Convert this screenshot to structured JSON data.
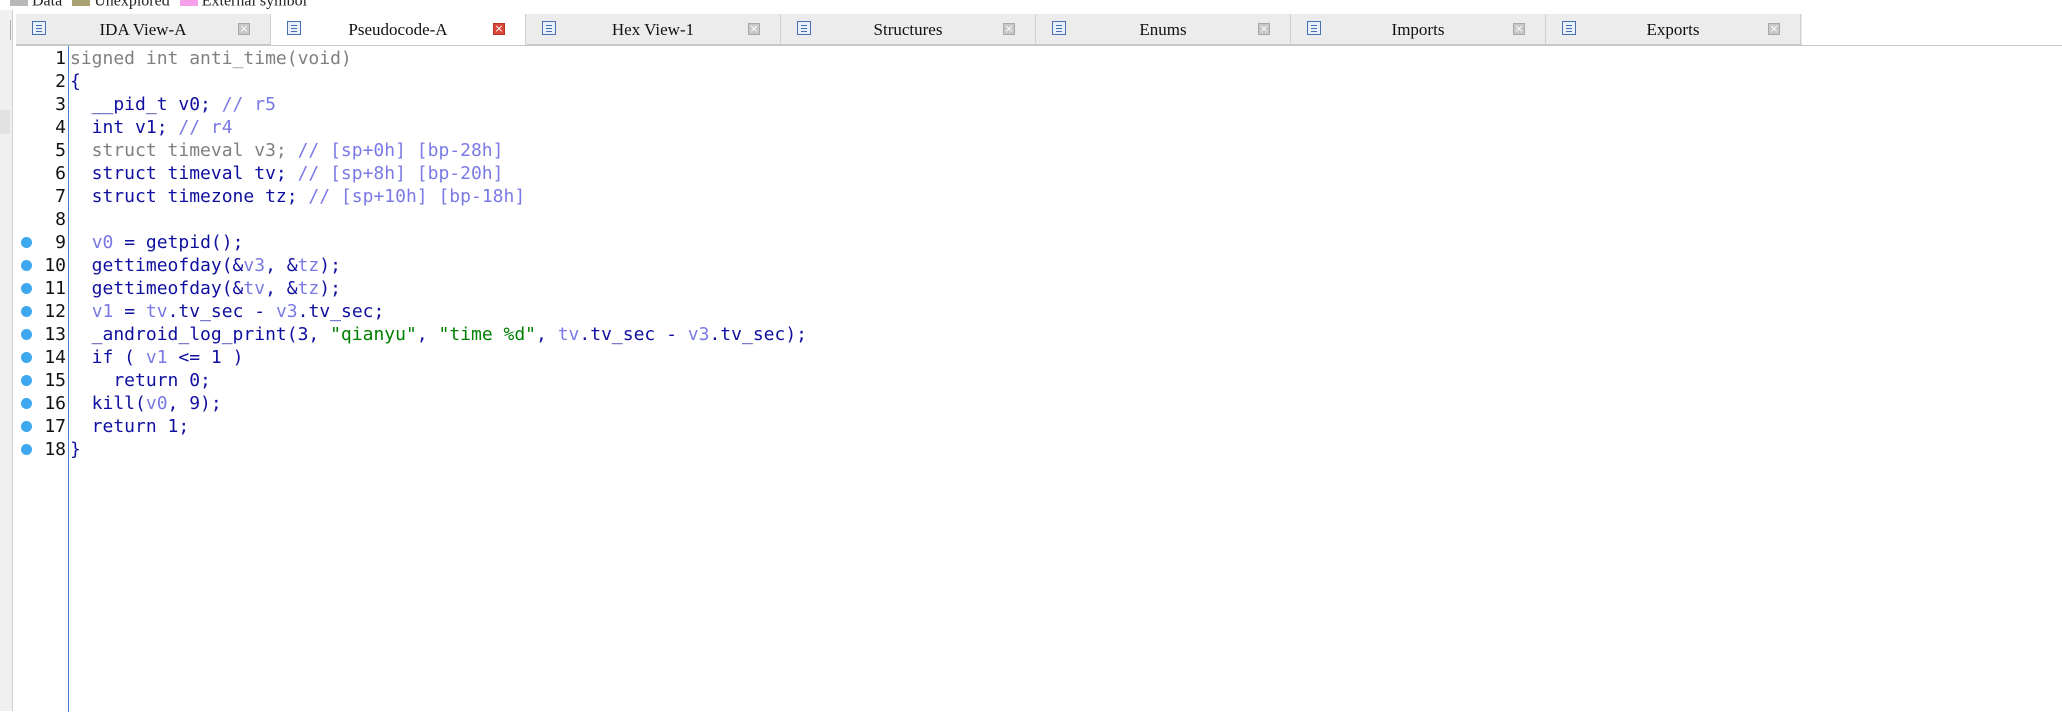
{
  "legend": [
    {
      "label": "Data",
      "color": "#b8b8b8"
    },
    {
      "label": "Unexplored",
      "color": "#a8a070"
    },
    {
      "label": "External symbol",
      "color": "#f5a0e8"
    }
  ],
  "tabs": [
    {
      "label": "IDA View-A",
      "icon": "ida-view-icon",
      "active": false
    },
    {
      "label": "Pseudocode-A",
      "icon": "pseudocode-icon",
      "active": true
    },
    {
      "label": "Hex View-1",
      "icon": "hex-view-icon",
      "active": false
    },
    {
      "label": "Structures",
      "icon": "structures-icon",
      "active": false
    },
    {
      "label": "Enums",
      "icon": "enums-icon",
      "active": false
    },
    {
      "label": "Imports",
      "icon": "imports-icon",
      "active": false
    },
    {
      "label": "Exports",
      "icon": "exports-icon",
      "active": false
    }
  ],
  "close_glyph": "×",
  "code": [
    {
      "n": "1",
      "bp": false,
      "parts": [
        {
          "t": "signed int anti_time(void)",
          "c": "g"
        }
      ]
    },
    {
      "n": "2",
      "bp": false,
      "parts": [
        {
          "t": "{",
          "c": "k"
        }
      ]
    },
    {
      "n": "3",
      "bp": false,
      "parts": [
        {
          "t": "  __pid_t v0; ",
          "c": "k"
        },
        {
          "t": "// r5",
          "c": "v"
        }
      ]
    },
    {
      "n": "4",
      "bp": false,
      "parts": [
        {
          "t": "  int v1; ",
          "c": "k"
        },
        {
          "t": "// r4",
          "c": "v"
        }
      ]
    },
    {
      "n": "5",
      "bp": false,
      "parts": [
        {
          "t": "  struct timeval v3; ",
          "c": "g"
        },
        {
          "t": "// [sp+0h] [bp-28h]",
          "c": "v"
        }
      ]
    },
    {
      "n": "6",
      "bp": false,
      "parts": [
        {
          "t": "  struct timeval tv; ",
          "c": "k"
        },
        {
          "t": "// [sp+8h] [bp-20h]",
          "c": "v"
        }
      ]
    },
    {
      "n": "7",
      "bp": false,
      "parts": [
        {
          "t": "  struct timezone tz; ",
          "c": "k"
        },
        {
          "t": "// [sp+10h] [bp-18h]",
          "c": "v"
        }
      ]
    },
    {
      "n": "8",
      "bp": false,
      "parts": [
        {
          "t": "",
          "c": "k"
        }
      ]
    },
    {
      "n": "9",
      "bp": true,
      "parts": [
        {
          "t": "  ",
          "c": "k"
        },
        {
          "t": "v0",
          "c": "v"
        },
        {
          "t": " = getpid();",
          "c": "k"
        }
      ]
    },
    {
      "n": "10",
      "bp": true,
      "parts": [
        {
          "t": "  gettimeofday(&",
          "c": "k"
        },
        {
          "t": "v3",
          "c": "v"
        },
        {
          "t": ", &",
          "c": "k"
        },
        {
          "t": "tz",
          "c": "v"
        },
        {
          "t": ");",
          "c": "k"
        }
      ]
    },
    {
      "n": "11",
      "bp": true,
      "parts": [
        {
          "t": "  gettimeofday(&",
          "c": "k"
        },
        {
          "t": "tv",
          "c": "v"
        },
        {
          "t": ", &",
          "c": "k"
        },
        {
          "t": "tz",
          "c": "v"
        },
        {
          "t": ");",
          "c": "k"
        }
      ]
    },
    {
      "n": "12",
      "bp": true,
      "parts": [
        {
          "t": "  ",
          "c": "k"
        },
        {
          "t": "v1",
          "c": "v"
        },
        {
          "t": " = ",
          "c": "k"
        },
        {
          "t": "tv",
          "c": "v"
        },
        {
          "t": ".tv_sec - ",
          "c": "k"
        },
        {
          "t": "v3",
          "c": "v"
        },
        {
          "t": ".tv_sec;",
          "c": "k"
        }
      ]
    },
    {
      "n": "13",
      "bp": true,
      "parts": [
        {
          "t": "  _android_log_print(3, ",
          "c": "k"
        },
        {
          "t": "\"qianyu\"",
          "c": "s"
        },
        {
          "t": ", ",
          "c": "k"
        },
        {
          "t": "\"time %d\"",
          "c": "s"
        },
        {
          "t": ", ",
          "c": "k"
        },
        {
          "t": "tv",
          "c": "v"
        },
        {
          "t": ".tv_sec - ",
          "c": "k"
        },
        {
          "t": "v3",
          "c": "v"
        },
        {
          "t": ".tv_sec);",
          "c": "k"
        }
      ]
    },
    {
      "n": "14",
      "bp": true,
      "parts": [
        {
          "t": "  if ( ",
          "c": "k"
        },
        {
          "t": "v1",
          "c": "v"
        },
        {
          "t": " <= 1 )",
          "c": "k"
        }
      ]
    },
    {
      "n": "15",
      "bp": true,
      "parts": [
        {
          "t": "    return 0;",
          "c": "k"
        }
      ]
    },
    {
      "n": "16",
      "bp": true,
      "parts": [
        {
          "t": "  kill(",
          "c": "k"
        },
        {
          "t": "v0",
          "c": "v"
        },
        {
          "t": ", 9);",
          "c": "k"
        }
      ]
    },
    {
      "n": "17",
      "bp": true,
      "parts": [
        {
          "t": "  return 1;",
          "c": "k"
        }
      ]
    },
    {
      "n": "18",
      "bp": true,
      "parts": [
        {
          "t": "}",
          "c": "k"
        }
      ]
    }
  ]
}
